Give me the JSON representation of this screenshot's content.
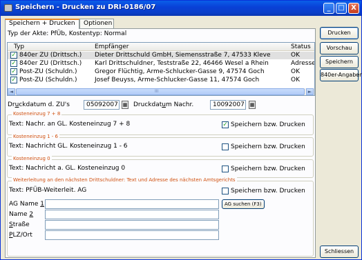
{
  "window": {
    "title": "Speichern - Drucken zu DRI-0186/07",
    "minimize": "_",
    "maximize": "□",
    "close": "X"
  },
  "tabs": [
    {
      "label": "Speichern + Drucken"
    },
    {
      "label": "Optionen"
    }
  ],
  "akte_info": "Typ der Akte: PfÜb, Kostentyp: Normal",
  "grid": {
    "columns": [
      "Typ",
      "Empfänger",
      "Status"
    ],
    "rows": [
      {
        "checked": "✓",
        "typ": "840er ZU (Drittsch.)",
        "empfaenger": "Dieter Drittschuld GmbH, Siemensstraße 7, 47533 Kleve",
        "status": "OK"
      },
      {
        "checked": "✓",
        "typ": "840er ZU (Drittsch.)",
        "empfaenger": "Karl Drittschuldner, Teststraße 22, 46466 Wesel a Rhein",
        "status": "Adresse"
      },
      {
        "checked": "✓",
        "typ": "Post-ZU (Schuldn.)",
        "empfaenger": "Gregor Flüchtig, Arme-Schlucker-Gasse 9, 47574 Goch",
        "status": "OK"
      },
      {
        "checked": "✓",
        "typ": "Post-ZU (Schuldn.)",
        "empfaenger": "Josef Beuyss, Arme-Schlucker-Gasse 11, 47574 Goch",
        "status": "OK"
      }
    ],
    "scroll_thumb_label": "III",
    "scroll_left": "◄",
    "scroll_right": "►"
  },
  "dates": {
    "druckdatum_zu_label_pre": "Dr",
    "druckdatum_zu_label_u": "u",
    "druckdatum_zu_label_post": "ckdatum d. ZU's",
    "druckdatum_zu_value": "05092007",
    "druckdatum_nachr_label_pre": "Druckdat",
    "druckdatum_nachr_label_u": "u",
    "druckdatum_nachr_label_post": "m Nachr.",
    "druckdatum_nachr_value": "10092007",
    "cal_icon": "▦"
  },
  "groups": [
    {
      "legend": "Kosteneinzug 7 + 8",
      "text": "Text: Nachr. an GL. Kosteneinzug 7 + 8",
      "check_label": "Speichern bzw. Drucken",
      "checked": "✓"
    },
    {
      "legend": "Kosteneinzug 1 - 6",
      "text": "Text: Nachricht GL. Kosteneinzug 1 - 6",
      "check_label": "Speichern bzw. Drucken",
      "checked": ""
    },
    {
      "legend": "Kosteneinzug 0",
      "text": "Text: Nachricht a. GL. Kosteneinzug 0",
      "check_label": "Speichern bzw. Drucken",
      "checked": ""
    }
  ],
  "weiterleitung": {
    "legend": "Weiterleitung an den nächsten Drittschuldner: Text und Adresse des nächsten Amtsgerichts",
    "text": "Text: PFÜB-Weiterleit. AG",
    "check_label": "Speichern bzw. Drucken",
    "checked": "",
    "ag_name_label_pre": "AG Name ",
    "ag_name_label_u": "1",
    "name2_label_pre": "Name ",
    "name2_label_u": "2",
    "strasse_label_u": "S",
    "strasse_label_post": "traße",
    "plz_label_u": "P",
    "plz_label_post": "LZ/Ort",
    "ag_suchen": "AG suchen (F3)",
    "ag_name_value": "",
    "name2_value": "",
    "strasse_value": "",
    "plz_value": ""
  },
  "buttons": {
    "drucken": "Drucken",
    "vorschau": "Vorschau",
    "speichern": "Speichern",
    "angaben": "840er-Angaben",
    "schliessen": "Schliessen"
  }
}
